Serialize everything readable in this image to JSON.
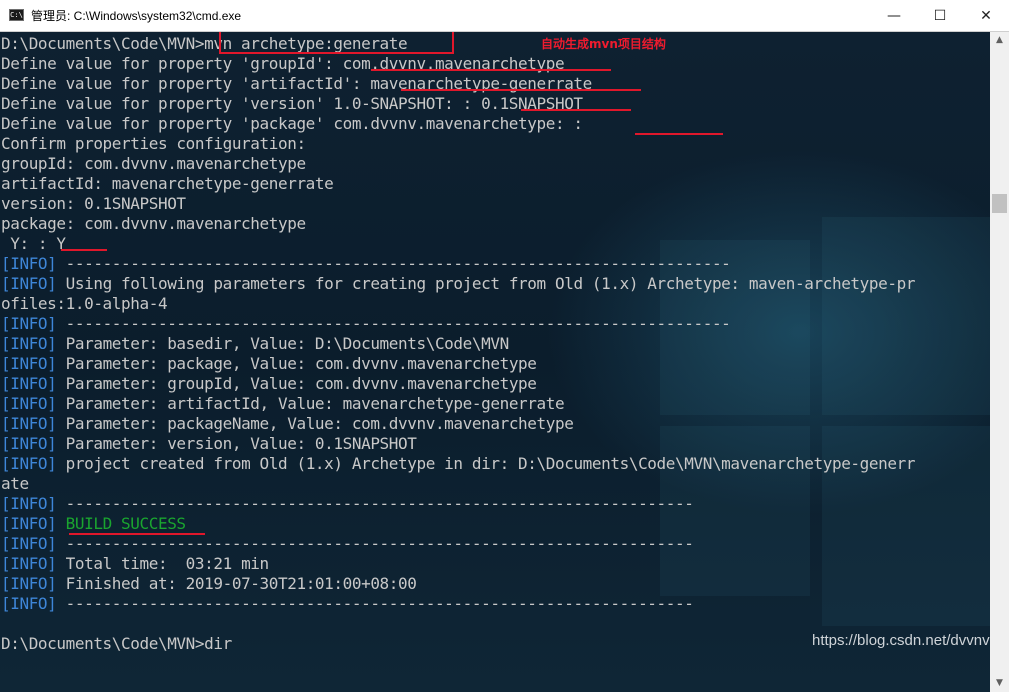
{
  "window": {
    "title": "管理员: C:\\Windows\\system32\\cmd.exe",
    "icon": "console-app-icon",
    "icon_glyph": "C:\\",
    "minimize_glyph": "—",
    "maximize_glyph": "☐",
    "close_glyph": "✕"
  },
  "annotation": "自动生成mvn项目结构",
  "watermark": "https://blog.csdn.net/dvvnv",
  "colors": {
    "info": "#3e86d8",
    "success": "#1aa52f",
    "text": "#c8c8c8",
    "highlight": "#e0172b"
  },
  "scrollbar": {
    "up_glyph": "▲",
    "down_glyph": "▼"
  },
  "console": {
    "l0": "D:\\Documents\\Code\\MVN>mvn archetype:generate",
    "l1": "Define value for property 'groupId': com.dvvnv.mavenarchetype",
    "l2": "Define value for property 'artifactId': mavenarchetype-generrate",
    "l3": "Define value for property 'version' 1.0-SNAPSHOT: : 0.1SNAPSHOT",
    "l4": "Define value for property 'package' com.dvvnv.mavenarchetype: :",
    "l5": "Confirm properties configuration:",
    "l6": "groupId: com.dvvnv.mavenarchetype",
    "l7": "artifactId: mavenarchetype-generrate",
    "l8": "version: 0.1SNAPSHOT",
    "l9": "package: com.dvvnv.mavenarchetype",
    "l10": " Y: : Y",
    "l11": "------------------------------------------------------------------------",
    "l12": "Using following parameters for creating project from Old (1.x) Archetype: maven-archetype-pr",
    "l13": "ofiles:1.0-alpha-4",
    "l14": "------------------------------------------------------------------------",
    "l15": "Parameter: basedir, Value: D:\\Documents\\Code\\MVN",
    "l16": "Parameter: package, Value: com.dvvnv.mavenarchetype",
    "l17": "Parameter: groupId, Value: com.dvvnv.mavenarchetype",
    "l18": "Parameter: artifactId, Value: mavenarchetype-generrate",
    "l19": "Parameter: packageName, Value: com.dvvnv.mavenarchetype",
    "l20": "Parameter: version, Value: 0.1SNAPSHOT",
    "l21": "project created from Old (1.x) Archetype in dir: D:\\Documents\\Code\\MVN\\mavenarchetype-generr",
    "l22": "ate",
    "l23": "--------------------------------------------------------------------",
    "l24": "BUILD SUCCESS",
    "l25": "--------------------------------------------------------------------",
    "l26": "Total time:  03:21 min",
    "l27": "Finished at: 2019-07-30T21:01:00+08:00",
    "l28": "--------------------------------------------------------------------",
    "l30": "D:\\Documents\\Code\\MVN>dir",
    "info_tag": "[INFO]"
  }
}
